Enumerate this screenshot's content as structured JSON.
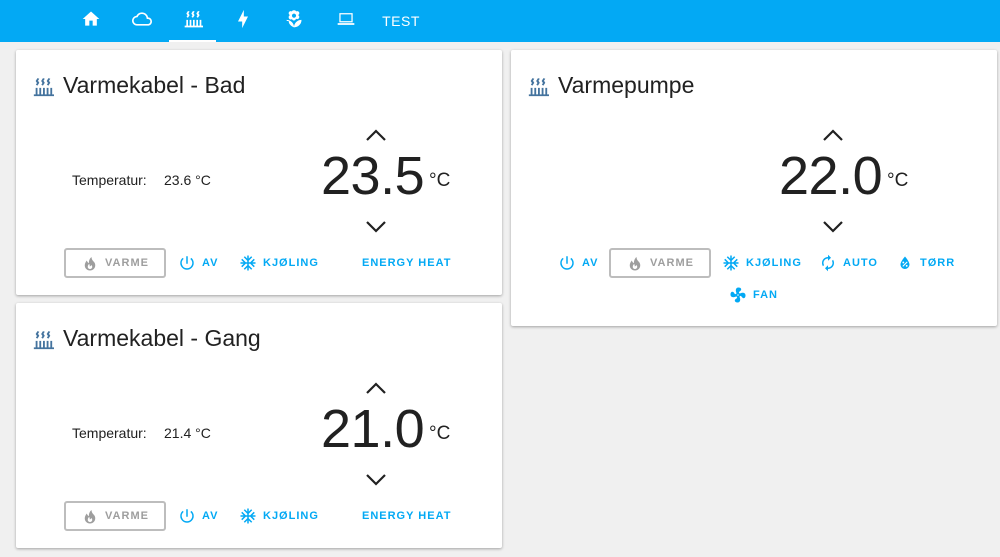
{
  "nav": {
    "tabs": [
      {
        "icon": "home-icon"
      },
      {
        "icon": "cloud-icon"
      },
      {
        "icon": "radiator-icon",
        "active": true
      },
      {
        "icon": "lightning-icon"
      },
      {
        "icon": "flower-icon"
      },
      {
        "icon": "laptop-icon"
      }
    ],
    "test_label": "TEST"
  },
  "colors": {
    "header": "#03a9f4",
    "accent": "#03a9f4",
    "icon": "#44739e",
    "selected_border": "#bdbdbd",
    "selected_text": "#9e9e9e"
  },
  "cards": {
    "bad": {
      "title": "Varmekabel - Bad",
      "current_label": "Temperatur:",
      "current_value": "23.6 °C",
      "target": "23.5",
      "unit": "°C",
      "modes": {
        "varme": "VARME",
        "av": "AV",
        "kjoling": "KJØLING",
        "energy_heat": "ENERGY HEAT"
      }
    },
    "gang": {
      "title": "Varmekabel - Gang",
      "current_label": "Temperatur:",
      "current_value": "21.4 °C",
      "target": "21.0",
      "unit": "°C",
      "modes": {
        "varme": "VARME",
        "av": "AV",
        "kjoling": "KJØLING",
        "energy_heat": "ENERGY HEAT"
      }
    },
    "pumpe": {
      "title": "Varmepumpe",
      "target": "22.0",
      "unit": "°C",
      "modes": {
        "av": "AV",
        "varme": "VARME",
        "kjoling": "KJØLING",
        "auto": "AUTO",
        "torr": "TØRR",
        "fan": "FAN"
      }
    }
  }
}
